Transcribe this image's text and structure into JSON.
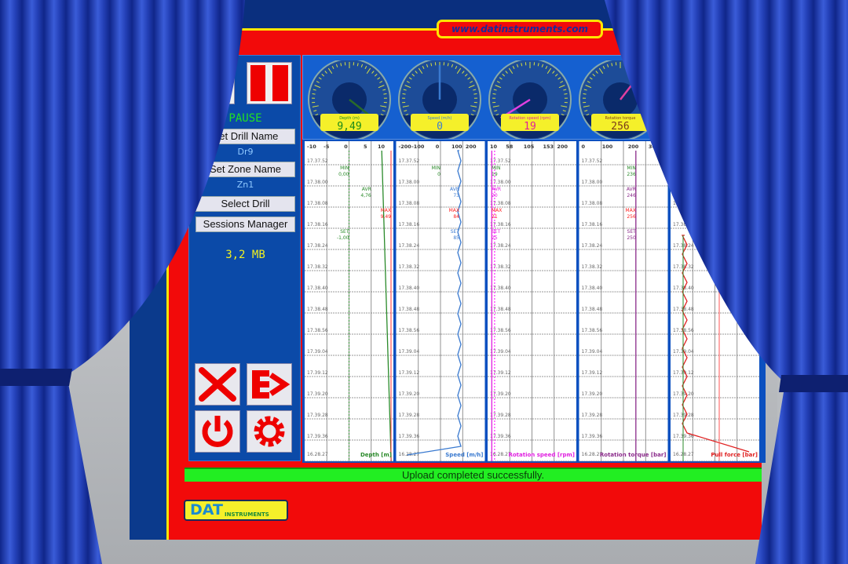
{
  "website": "www.datinstruments.com",
  "logo": {
    "brand": "DAT",
    "sub": "INSTRUMENTS"
  },
  "left_panel": {
    "state": "PAUSE",
    "set_drill_label": "Set Drill Name",
    "drill_name": "Dr9",
    "set_zone_label": "Set Zone Name",
    "zone_name": "Zn1",
    "select_drill_label": "Select Drill",
    "sessions_label": "Sessions Manager",
    "storage": "3,2 MB",
    "icons": [
      "record-icon",
      "pause-icon",
      "tools-icon",
      "export-icon",
      "power-icon",
      "settings-gear-icon"
    ]
  },
  "gauges": [
    {
      "label": "Depth (m)",
      "value": "9,49",
      "color": "#1a8a1a",
      "needle": "#2a6a2a",
      "min": -10,
      "max": 10,
      "reading": 9.49
    },
    {
      "label": "Speed (m/h)",
      "value": "0",
      "color": "#3a7ad0",
      "needle": "#3a7ad0",
      "min": -200,
      "max": 200,
      "reading": 0
    },
    {
      "label": "Rotation speed (rpm)",
      "value": "19",
      "color": "#e0209a",
      "needle": "#e040e0",
      "min": 10,
      "max": 200,
      "reading": 19
    },
    {
      "label": "Rotation torque",
      "value": "256",
      "color": "#7a3a1a",
      "needle": "#e040a0",
      "min": 0,
      "max": 400,
      "reading": 256
    }
  ],
  "time_labels": [
    "17.37.52",
    "17.38.00",
    "17.38.08",
    "17.38.16",
    "17.38.24",
    "17.38.32",
    "17.38.40",
    "17.38.48",
    "17.38.56",
    "17.39.04",
    "17.39.12",
    "17.39.20",
    "17.39.28",
    "17.39.36",
    "16.28.27"
  ],
  "columns": [
    {
      "title": "Depth [m]",
      "color": "#2a8a2a",
      "ticks": [
        "-10",
        "-5",
        "0",
        "5",
        "10"
      ],
      "range": [
        -10,
        10
      ],
      "stats": {
        "MIN": "0,00",
        "AVR": "4,76",
        "MAX": "9,49",
        "SET": "-1,00"
      }
    },
    {
      "title": "Speed [m/h]",
      "color": "#3a7ad0",
      "ticks": [
        "-200",
        "-100",
        "0",
        "100",
        "200"
      ],
      "range": [
        -200,
        200
      ],
      "stats": {
        "MIN": "0",
        "AVR": "73",
        "MAX": "84",
        "SET": "85"
      }
    },
    {
      "title": "Rotation speed [rpm]",
      "color": "#e020e0",
      "ticks": [
        "10",
        "58",
        "105",
        "153",
        "200"
      ],
      "range": [
        10,
        200
      ],
      "stats": {
        "MIN": "19",
        "AVR": "20",
        "MAX": "21",
        "SET": "25"
      }
    },
    {
      "title": "Rotation torque [bar]",
      "color": "#8a2a8a",
      "ticks": [
        "0",
        "100",
        "200",
        "300"
      ],
      "range": [
        0,
        400
      ],
      "stats": {
        "MIN": "236",
        "AVR": "246",
        "MAX": "256",
        "SET": "250"
      }
    },
    {
      "title": "Pull force [bar]",
      "color": "#e02020",
      "ticks": [],
      "range": [
        0,
        400
      ],
      "stats": {}
    }
  ],
  "status": "Upload completed successfully.",
  "colors": {
    "frame_red": "#f20a0a",
    "frame_yellow": "#ffe600",
    "panel_blue": "#0b4aa8",
    "curtain": "#1f3aa8",
    "status_green": "#22ee22"
  }
}
